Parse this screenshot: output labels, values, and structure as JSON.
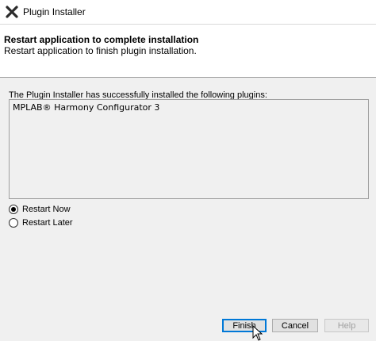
{
  "window": {
    "title": "Plugin Installer",
    "icon": "close-x-app-icon"
  },
  "header": {
    "title": "Restart application to complete installation",
    "subtitle": "Restart application to finish plugin installation."
  },
  "content": {
    "info_label": "The Plugin Installer has successfully installed the following plugins:",
    "plugins": [
      "MPLAB® Harmony Configurator 3"
    ]
  },
  "restart_options": [
    {
      "label": "Restart Now",
      "selected": true
    },
    {
      "label": "Restart Later",
      "selected": false
    }
  ],
  "buttons": {
    "finish": "Finish",
    "cancel": "Cancel",
    "help": "Help"
  }
}
